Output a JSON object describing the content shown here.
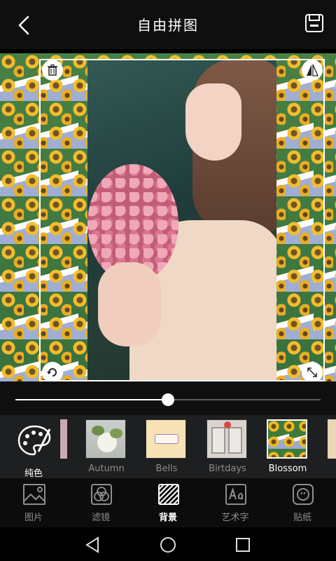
{
  "header": {
    "title": "自由拼图",
    "back_icon": "chevron-left-icon",
    "save_icon": "save-icon"
  },
  "canvas": {
    "background_pattern": "Blossom",
    "buttons": {
      "delete_icon": "trash-icon",
      "flip_icon": "flip-icon",
      "rotate_icon": "rotate-icon",
      "scale_icon": "resize-icon"
    }
  },
  "slider": {
    "value_fraction": 0.5
  },
  "background_options": {
    "solid_label": "纯色",
    "items": [
      {
        "label": "Autumn",
        "selected": false
      },
      {
        "label": "Bells",
        "selected": false
      },
      {
        "label": "Birtdays",
        "selected": false
      },
      {
        "label": "Blossom",
        "selected": true
      }
    ]
  },
  "toolbar": {
    "items": [
      {
        "label": "图片",
        "icon": "image-icon",
        "active": false
      },
      {
        "label": "滤镜",
        "icon": "filter-icon",
        "active": false
      },
      {
        "label": "背景",
        "icon": "background-icon",
        "active": true
      },
      {
        "label": "艺术字",
        "icon": "text-art-icon",
        "active": false
      },
      {
        "label": "贴纸",
        "icon": "sticker-icon",
        "active": false
      }
    ]
  },
  "colors": {
    "header_bg": "#0f0f10",
    "strip_bg": "#1e1f21",
    "toolbar_bg": "#0c0c0d",
    "accent": "#ffffff",
    "inactive_text": "#8e8e8e"
  }
}
